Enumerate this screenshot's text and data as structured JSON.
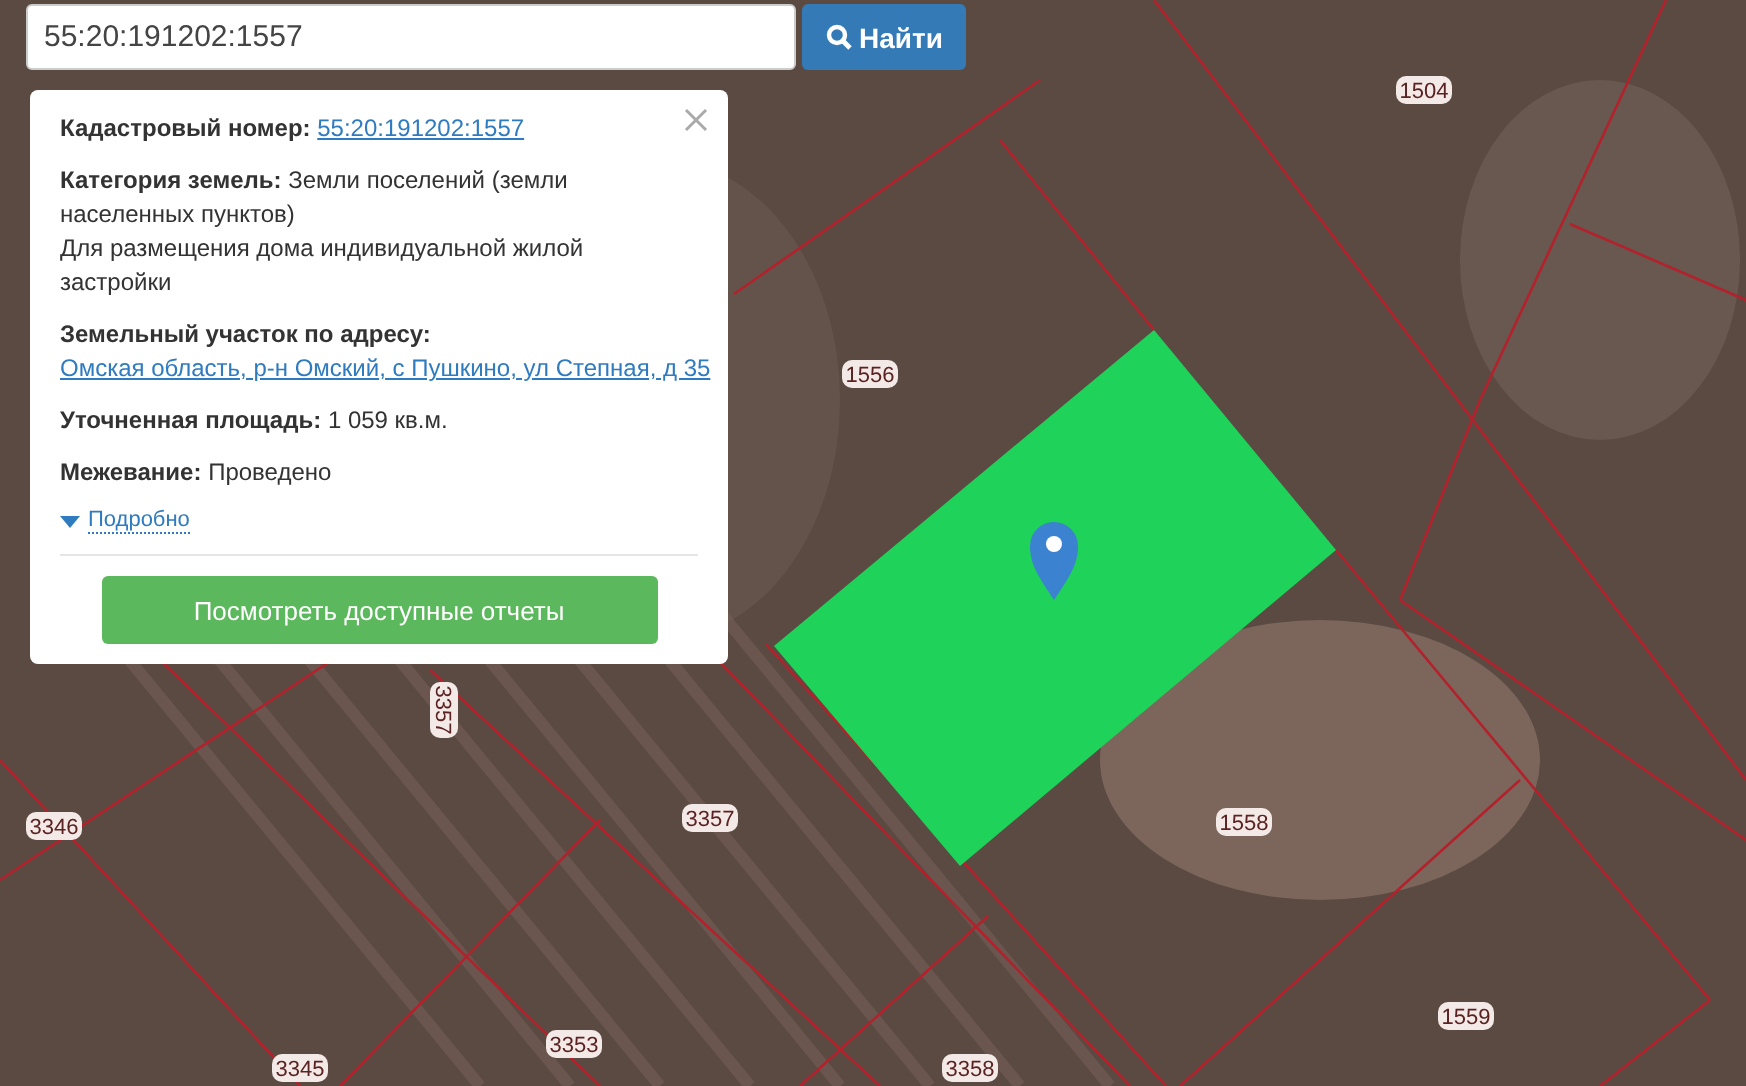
{
  "search": {
    "value": "55:20:191202:1557",
    "button_label": "Найти"
  },
  "popup": {
    "fields": [
      {
        "label": "Кадастровый номер:",
        "kind": "link",
        "lines": [
          "55:20:191202:1557"
        ]
      },
      {
        "label": "Категория земель:",
        "kind": "text",
        "lines": [
          "Земли поселений (земли населенных пунктов)",
          "Для размещения дома индивидуальной жилой застройки"
        ]
      },
      {
        "label": "Земельный участок по адресу:",
        "kind": "link",
        "lines": [
          "Омская область, р-н Омский, с Пушкино, ул Степная, д 35"
        ]
      },
      {
        "label": "Уточненная площадь:",
        "kind": "text",
        "lines": [
          "1 059 кв.м."
        ]
      },
      {
        "label": "Межевание:",
        "kind": "text",
        "lines": [
          "Проведено"
        ]
      }
    ],
    "more_link": "Подробно",
    "expanded": false,
    "report_button": "Посмотреть доступные отчеты"
  },
  "map": {
    "parcel_labels": [
      {
        "text": "1504"
      },
      {
        "text": "1556"
      },
      {
        "text": "3357"
      },
      {
        "text": "3346"
      },
      {
        "text": "3357"
      },
      {
        "text": "1558"
      },
      {
        "text": "1559"
      },
      {
        "text": "3353"
      },
      {
        "text": "3345"
      },
      {
        "text": "3358"
      }
    ]
  }
}
